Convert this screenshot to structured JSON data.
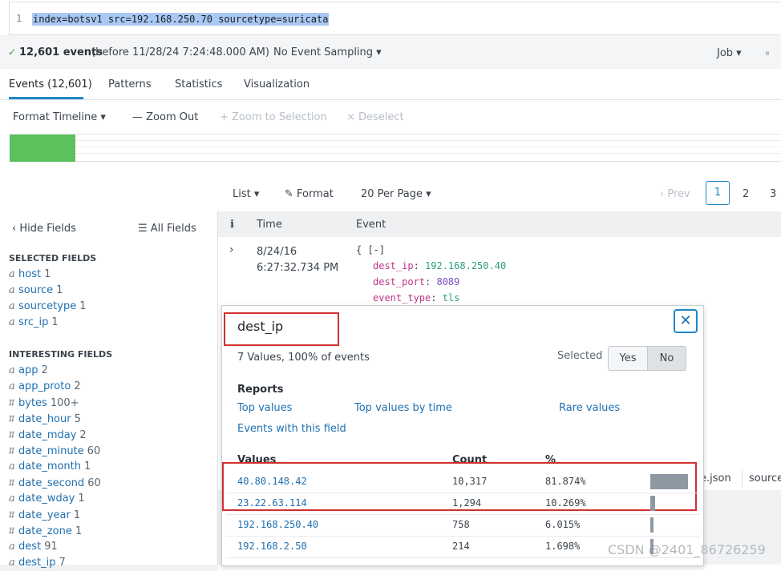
{
  "search": {
    "line_number": "1",
    "query": "index=botsv1 src=192.168.250.70 sourcetype=suricata"
  },
  "status": {
    "check": "✓",
    "event_count": "12,601 events",
    "before": "(before 11/28/24 7:24:48.000 AM)",
    "sampling": "No Event Sampling ▾",
    "job": "Job ▾",
    "pause": "⏸"
  },
  "tabs": [
    "Events (12,601)",
    "Patterns",
    "Statistics",
    "Visualization"
  ],
  "timeline_toolbar": {
    "format": "Format Timeline ▾",
    "zoom_out": "— Zoom Out",
    "zoom_selection": "+ Zoom to Selection",
    "deselect": "× Deselect"
  },
  "list_toolbar": {
    "list": "List ▾",
    "format": "Format",
    "per_page": "20 Per Page ▾"
  },
  "pager": {
    "prev": "‹ Prev",
    "pages": [
      "1",
      "2",
      "3"
    ]
  },
  "sidebar": {
    "hide_fields": "‹ Hide Fields",
    "all_fields": "☰ All Fields",
    "selected_header": "SELECTED FIELDS",
    "selected": [
      {
        "type": "a",
        "name": "host",
        "count": "1"
      },
      {
        "type": "a",
        "name": "source",
        "count": "1"
      },
      {
        "type": "a",
        "name": "sourcetype",
        "count": "1"
      },
      {
        "type": "a",
        "name": "src_ip",
        "count": "1"
      }
    ],
    "interesting_header": "INTERESTING FIELDS",
    "interesting": [
      {
        "type": "a",
        "name": "app",
        "count": "2"
      },
      {
        "type": "a",
        "name": "app_proto",
        "count": "2"
      },
      {
        "type": "#",
        "name": "bytes",
        "count": "100+"
      },
      {
        "type": "#",
        "name": "date_hour",
        "count": "5"
      },
      {
        "type": "#",
        "name": "date_mday",
        "count": "2"
      },
      {
        "type": "#",
        "name": "date_minute",
        "count": "60"
      },
      {
        "type": "a",
        "name": "date_month",
        "count": "1"
      },
      {
        "type": "#",
        "name": "date_second",
        "count": "60"
      },
      {
        "type": "a",
        "name": "date_wday",
        "count": "1"
      },
      {
        "type": "#",
        "name": "date_year",
        "count": "1"
      },
      {
        "type": "#",
        "name": "date_zone",
        "count": "1"
      },
      {
        "type": "a",
        "name": "dest",
        "count": "91"
      },
      {
        "type": "a",
        "name": "dest_ip",
        "count": "7"
      }
    ]
  },
  "events": {
    "header": {
      "info": "i",
      "time": "Time",
      "event": "Event"
    },
    "row": {
      "date": "8/24/16",
      "time": "6:27:32.734 PM",
      "open": "{ [-]",
      "fields": [
        {
          "key": "dest_ip",
          "value": "192.168.250.40"
        },
        {
          "key": "dest_port",
          "value": "8089"
        },
        {
          "key": "event_type",
          "value": "tls"
        }
      ]
    },
    "fragments": {
      "json": "e.json",
      "source": "source"
    }
  },
  "popup": {
    "title": "dest_ip",
    "summary": "7 Values, 100% of events",
    "selected_label": "Selected",
    "yes": "Yes",
    "no": "No",
    "reports_header": "Reports",
    "reports": [
      "Top values",
      "Top values by time",
      "Rare values",
      "Events with this field"
    ],
    "columns": {
      "values": "Values",
      "count": "Count",
      "pct": "%"
    },
    "rows": [
      {
        "value": "40.80.148.42",
        "count": "10,317",
        "pct": "81.874%",
        "fraction": 0.81874
      },
      {
        "value": "23.22.63.114",
        "count": "1,294",
        "pct": "10.269%",
        "fraction": 0.10269
      },
      {
        "value": "192.168.250.40",
        "count": "758",
        "pct": "6.015%",
        "fraction": 0.06015
      },
      {
        "value": "192.168.2.50",
        "count": "214",
        "pct": "1.698%",
        "fraction": 0.01698
      }
    ]
  },
  "watermark": "CSDN @2401_86726259",
  "colors": {
    "accent": "#1e87c9",
    "link": "#1e6fb0",
    "highlight_box": "#d32f2f",
    "timeline_bar": "#5cc05c"
  }
}
